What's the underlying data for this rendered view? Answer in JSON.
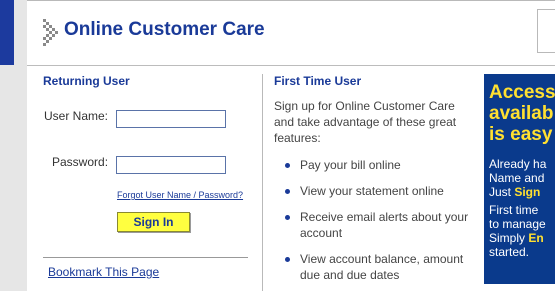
{
  "header": {
    "title": "Online Customer Care"
  },
  "returning_user": {
    "title": "Returning User",
    "username_label": "User Name:",
    "username_value": "",
    "password_label": "Password:",
    "password_value": "",
    "forgot_link": "Forgot User Name / Password?",
    "signin_label": "Sign In",
    "bookmark_link": "Bookmark This Page"
  },
  "first_time_user": {
    "title": "First Time User",
    "intro": "Sign up for Online Customer Care and take advantage of these great features:",
    "features": [
      "Pay your bill online",
      "View your statement online",
      "Receive email alerts about your account",
      "View account balance, amount due and due dates"
    ]
  },
  "promo": {
    "heading": "Access\navailab\nis easy",
    "line1": "Already ha",
    "line2": "Name and",
    "line3_prefix": "Just ",
    "line3_em": "Sign",
    "line4": "First time",
    "line5": "to manage",
    "line6_prefix": "Simply ",
    "line6_em": "En",
    "line7": "started."
  },
  "colors": {
    "brand_blue": "#1a3a98",
    "button_yellow": "#ffff40",
    "promo_bg": "#0a3a8c",
    "promo_accent": "#ffe030"
  }
}
